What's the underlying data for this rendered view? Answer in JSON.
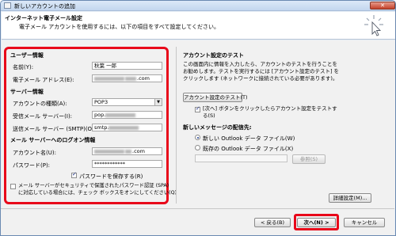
{
  "window": {
    "title": "新しいアカウントの追加",
    "close_glyph": "✕"
  },
  "header": {
    "title": "インターネット電子メール設定",
    "subtitle": "電子メール アカウントを使用するには、以下の項目をすべて設定してください。"
  },
  "left": {
    "user_info_heading": "ユーザー情報",
    "name_label": "名前(Y):",
    "name_value": "秋葉 一郎",
    "email_label": "電子メール アドレス(E):",
    "email_suffix": ".com",
    "server_heading": "サーバー情報",
    "account_type_label": "アカウントの種類(A):",
    "account_type_value": "POP3",
    "incoming_label": "受信メール サーバー(I):",
    "incoming_prefix": "pop.",
    "outgoing_label": "送信メール サーバー (SMTP)(O):",
    "outgoing_prefix": "smtp.",
    "logon_heading": "メール サーバーへのログオン情報",
    "account_name_label": "アカウント名(U):",
    "account_name_suffix": ".com",
    "password_label": "パスワード(P):",
    "password_value": "************",
    "save_password_label": "パスワードを保存する(R)",
    "spa_label_line1": "メール サーバーがセキュリティで保護されたパスワード認証 (SPA)",
    "spa_label_line2": "に対応している場合には、チェック ボックスをオンにしてください(Q)"
  },
  "right": {
    "test_heading": "アカウント設定のテスト",
    "test_help_line1": "この画面内に情報を入力したら、アカウントのテストを行うことを",
    "test_help_line2": "お勧めします。テストを実行するには [アカウント設定のテスト] を",
    "test_help_line3": "クリックします (ネットワークに接続されている必要があります)。",
    "test_button": "アカウント設定のテスト(T)",
    "auto_test_line1": "[次へ] ボタンをクリックしたらアカウント設定をテストす",
    "auto_test_line2": "る(S)",
    "delivery_heading": "新しいメッセージの配信先:",
    "radio_new_pst": "新しい Outlook データ ファイル(W)",
    "radio_existing_pst": "既存の Outlook データ ファイル(X)",
    "browse_button": "参照(S)",
    "more_settings_button": "詳細設定(M)..."
  },
  "footer": {
    "back_button": "< 戻る(B)",
    "next_button": "次へ(N) >",
    "cancel_button": "キャンセル"
  },
  "colors": {
    "highlight_red": "#e8081a",
    "window_border": "#6b89b1"
  }
}
